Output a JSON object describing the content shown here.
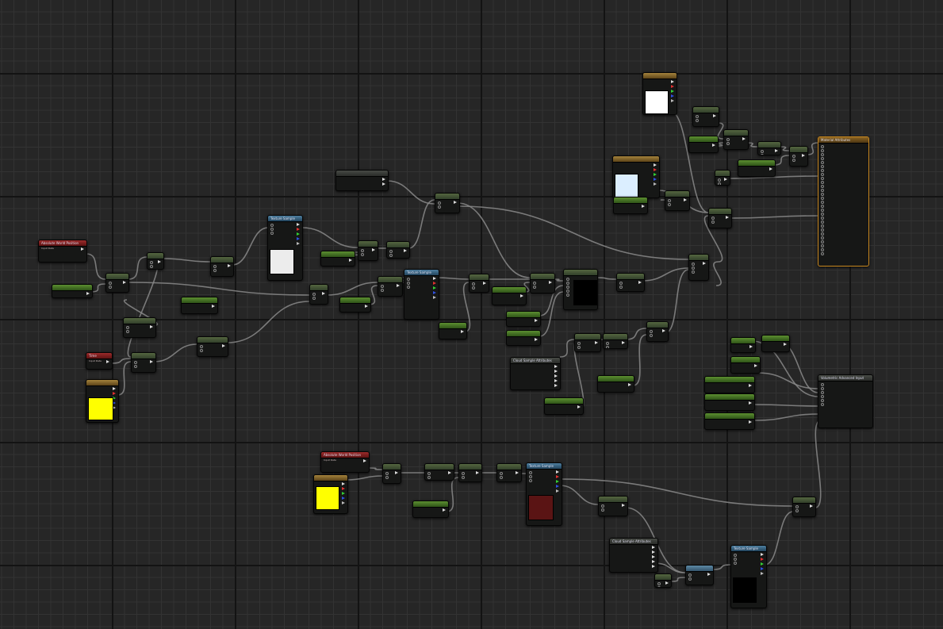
{
  "editor": {
    "accent_output": "#c7871f",
    "node_colors": {
      "math": "#4a5a3a",
      "constant": "#4f7f2b",
      "texture": "#3f6b88",
      "input": "#8f2222",
      "vector_param": "#9a7830"
    }
  },
  "nodes": [
    {
      "id": "n1",
      "label": "Absolute World Position",
      "sub": "Input Data",
      "kind": "red"
    },
    {
      "id": "n2",
      "label": "Time",
      "sub": "Input Data",
      "kind": "red"
    },
    {
      "id": "n3",
      "label": "Absolute World Position",
      "sub": "Input Data",
      "kind": "red"
    },
    {
      "id": "n4",
      "label": "Texture Sample",
      "kind": "tex"
    },
    {
      "id": "n5",
      "label": "Texture Sample",
      "kind": "tex"
    },
    {
      "id": "n6",
      "label": "Texture Sample",
      "kind": "tex"
    },
    {
      "id": "n7",
      "label": "Texture Sample",
      "kind": "tex"
    },
    {
      "id": "n8",
      "label": "Material Attributes",
      "kind": "out"
    },
    {
      "id": "n9",
      "label": "Cloud Sample Attributes",
      "kind": "gray"
    },
    {
      "id": "n10",
      "label": "Cloud Sample Attributes",
      "kind": "gray"
    },
    {
      "id": "n11",
      "label": "Volumetric Advanced Input",
      "kind": "gray"
    },
    {
      "id": "n12",
      "label": "Volumetric Advanced Input",
      "kind": "gray"
    }
  ]
}
